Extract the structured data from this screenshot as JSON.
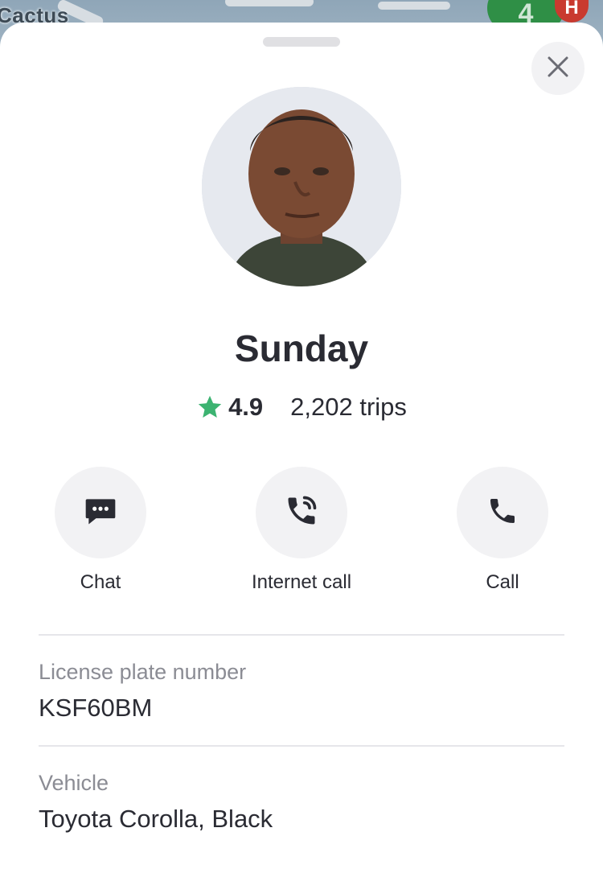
{
  "map": {
    "label": "Cactus",
    "route_badge": "4",
    "poi_badge": "H"
  },
  "driver": {
    "name": "Sunday",
    "rating": "4.9",
    "trips": "2,202 trips"
  },
  "actions": [
    {
      "label": "Chat",
      "icon": "chat-bubble-icon"
    },
    {
      "label": "Internet call",
      "icon": "internet-call-icon"
    },
    {
      "label": "Call",
      "icon": "phone-icon"
    }
  ],
  "details": {
    "plate_label": "License plate number",
    "plate_value": "KSF60BM",
    "vehicle_label": "Vehicle",
    "vehicle_value": "Toyota Corolla, Black"
  },
  "colors": {
    "star": "#3cb371",
    "text": "#2a2b33",
    "muted": "#8b8c94",
    "button_bg": "#f2f2f4"
  }
}
